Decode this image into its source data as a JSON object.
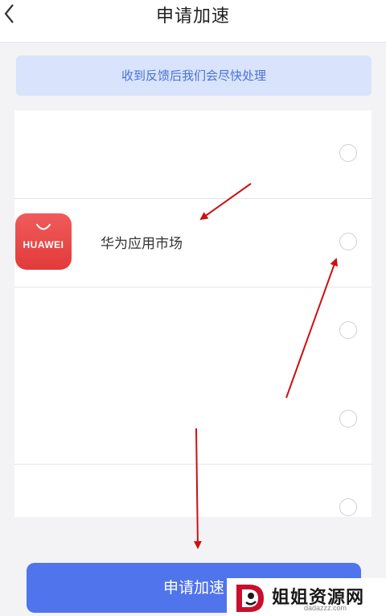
{
  "header": {
    "title": "申请加速"
  },
  "notice": {
    "text": "收到反馈后我们会尽快处理"
  },
  "app_list": {
    "items": [
      {
        "name": "",
        "selected": false
      },
      {
        "name": "华为应用市场",
        "icon_brand": "HUAWEI",
        "selected": false
      },
      {
        "name": "",
        "selected": false
      },
      {
        "name": "",
        "selected": false
      },
      {
        "name": "",
        "selected": false
      }
    ]
  },
  "footer": {
    "submit_label": "申请加速"
  },
  "watermark": {
    "text": "姐姐资源网",
    "domain": "dadazzz.com"
  },
  "colors": {
    "accent": "#4f74ec",
    "notice_bg": "#d9e3fb",
    "notice_text": "#4a73d6",
    "huawei_red": "#e23a3a",
    "annotation_arrow": "#cc1111"
  },
  "icons": [
    "back-icon",
    "huawei-appgallery-icon",
    "radio-icon"
  ]
}
